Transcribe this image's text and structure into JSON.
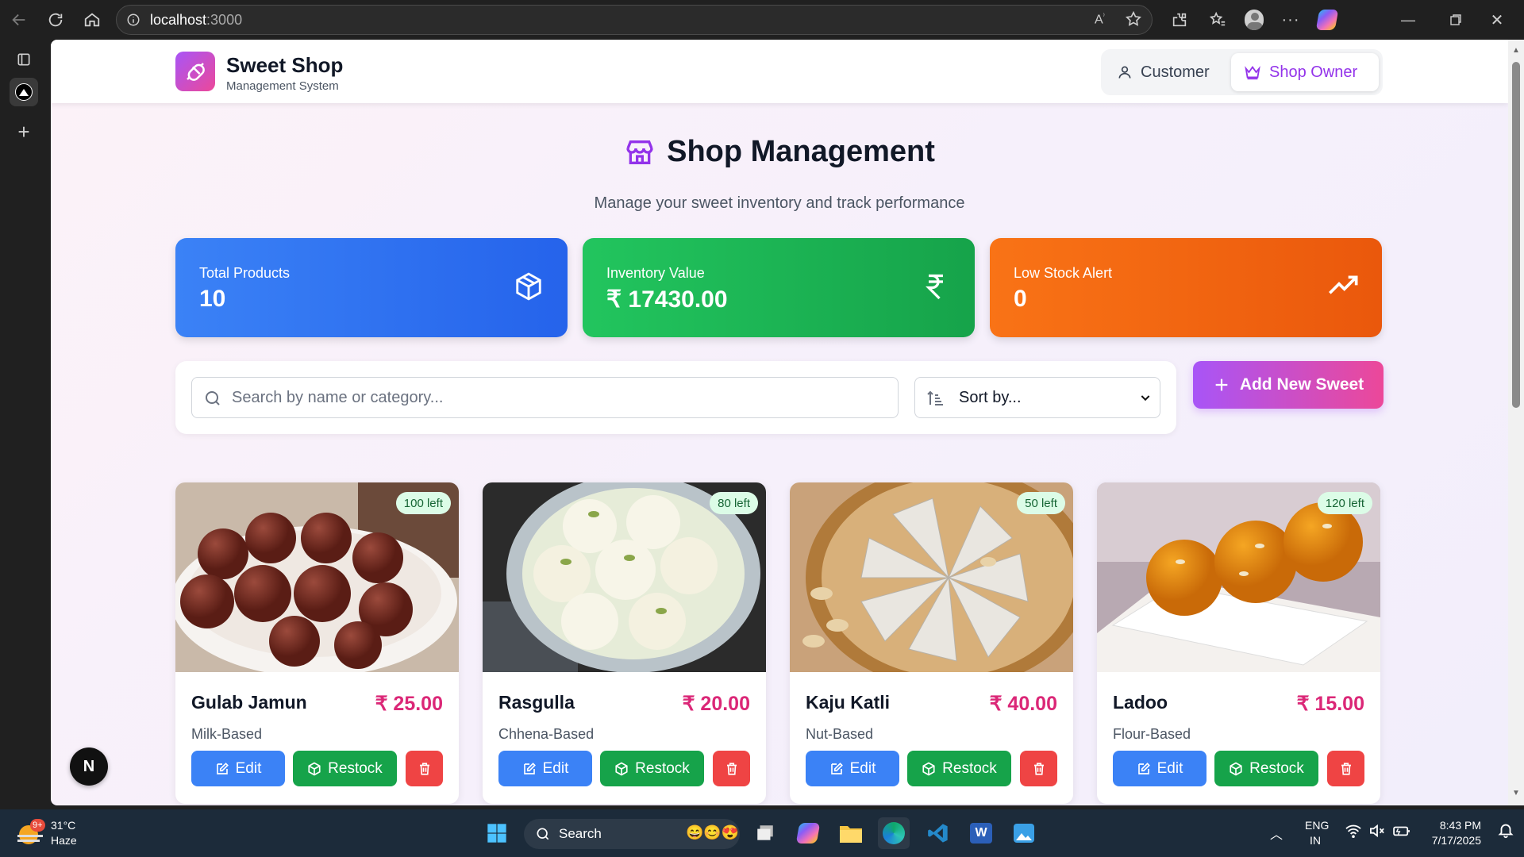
{
  "browser": {
    "url_host": "localhost",
    "url_port": ":3000"
  },
  "header": {
    "brand_title": "Sweet Shop",
    "brand_subtitle": "Management System",
    "mode_customer": "Customer",
    "mode_owner": "Shop Owner"
  },
  "page": {
    "title": "Shop Management",
    "subtitle": "Manage your sweet inventory and track performance"
  },
  "stats": [
    {
      "label": "Total Products",
      "value": "10",
      "icon": "box-icon",
      "color": "#2563eb"
    },
    {
      "label": "Inventory Value",
      "value": "₹ 17430.00",
      "icon": "rupee-icon",
      "color": "#16a34a"
    },
    {
      "label": "Low Stock Alert",
      "value": "0",
      "icon": "trending-up-icon",
      "color": "#ea580c"
    }
  ],
  "toolbar": {
    "search_placeholder": "Search by name or category...",
    "sort_label": "Sort by...",
    "add_label": "Add New Sweet"
  },
  "products": [
    {
      "name": "Gulab Jamun",
      "price": "₹ 25.00",
      "category": "Milk-Based",
      "stock": "100 left"
    },
    {
      "name": "Rasgulla",
      "price": "₹ 20.00",
      "category": "Chhena-Based",
      "stock": "80 left"
    },
    {
      "name": "Kaju Katli",
      "price": "₹ 40.00",
      "category": "Nut-Based",
      "stock": "50 left"
    },
    {
      "name": "Ladoo",
      "price": "₹ 15.00",
      "category": "Flour-Based",
      "stock": "120 left"
    }
  ],
  "card_actions": {
    "edit": "Edit",
    "restock": "Restock"
  },
  "dev_badge": "N",
  "taskbar": {
    "weather_temp": "31°C",
    "weather_desc": "Haze",
    "weather_badge": "9+",
    "search_label": "Search",
    "lang_primary": "ENG",
    "lang_secondary": "IN",
    "time": "8:43 PM",
    "date": "7/17/2025"
  },
  "colors": {
    "accent_purple": "#9333ea",
    "accent_pink": "#db2777",
    "edit_blue": "#3b82f6",
    "restock_green": "#16a34a",
    "delete_red": "#ef4444"
  }
}
